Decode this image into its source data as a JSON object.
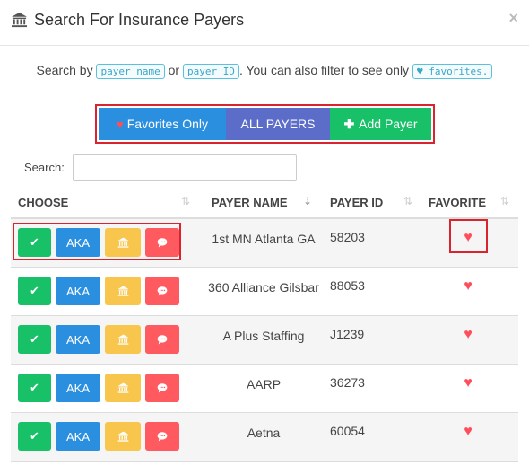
{
  "modal": {
    "title": "Search For Insurance Payers",
    "close": "×"
  },
  "intro": {
    "prefix": "Search by",
    "code1": "payer name",
    "or": "or",
    "code2": "payer ID",
    "middle": ". You can also filter to see only",
    "code3": "favorites."
  },
  "buttons": {
    "favorites": "Favorites Only",
    "all": "ALL PAYERS",
    "add": "Add Payer"
  },
  "search": {
    "label": "Search:",
    "value": ""
  },
  "columns": {
    "choose": "CHOOSE",
    "payer_name": "PAYER NAME",
    "payer_id": "PAYER ID",
    "favorite": "FAVORITE"
  },
  "row_actions": {
    "aka": "AKA"
  },
  "rows": [
    {
      "name": "1st MN Atlanta GA",
      "id": "58203"
    },
    {
      "name": "360 Alliance Gilsbar",
      "id": "88053"
    },
    {
      "name": "A Plus Staffing",
      "id": "J1239"
    },
    {
      "name": "AARP",
      "id": "36273"
    },
    {
      "name": "Aetna",
      "id": "60054"
    }
  ],
  "colors": {
    "green": "#18c168",
    "blue": "#2b8fe0",
    "purple": "#5b6cc9",
    "yellow": "#f8c54d",
    "red": "#ff5a5f",
    "highlight": "#d9232e"
  }
}
